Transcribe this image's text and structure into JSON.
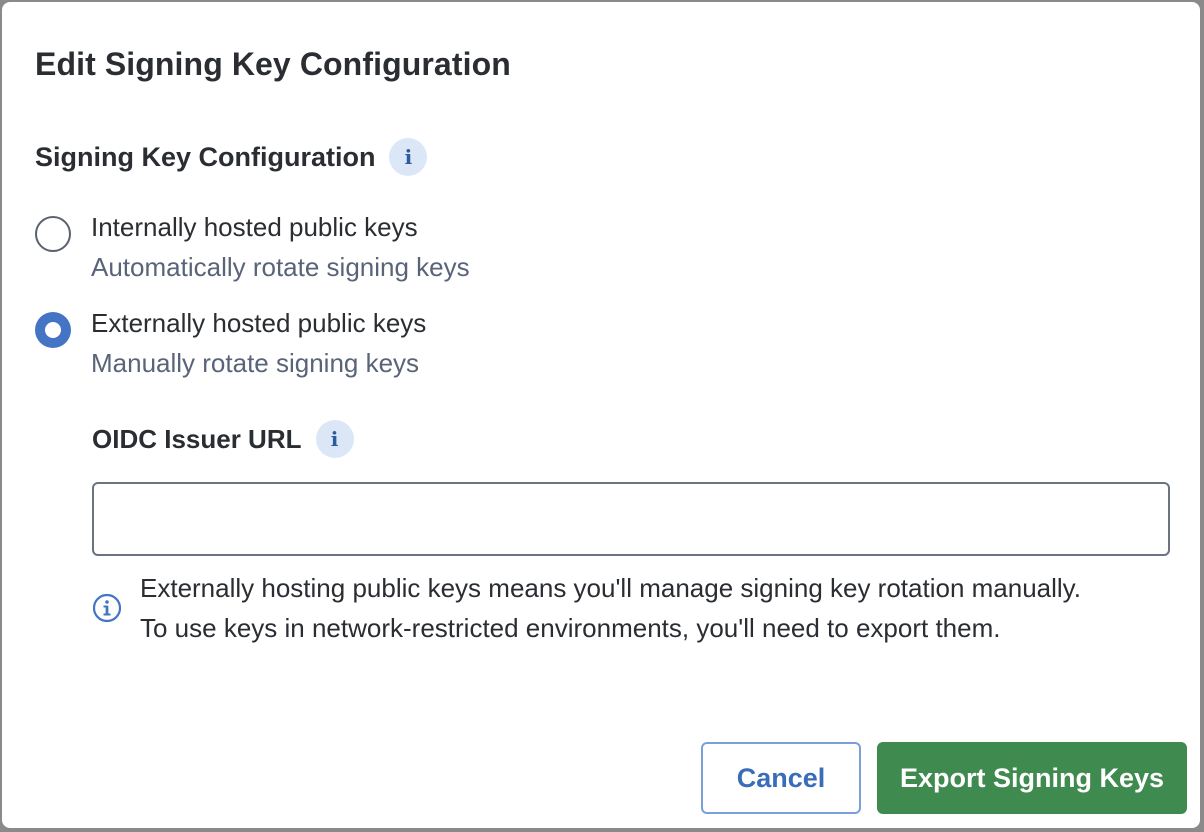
{
  "dialog": {
    "title": "Edit Signing Key Configuration",
    "section_label": "Signing Key Configuration",
    "options": [
      {
        "label": "Internally hosted public keys",
        "description": "Automatically rotate signing keys",
        "selected": false
      },
      {
        "label": "Externally hosted public keys",
        "description": "Manually rotate signing keys",
        "selected": true
      }
    ],
    "oidc_field": {
      "label": "OIDC Issuer URL",
      "value": "",
      "placeholder": ""
    },
    "helper_text": "Externally hosting public keys means you'll manage signing key rotation manually. To use keys in network-restricted environments, you'll need to export them.",
    "buttons": {
      "cancel_label": "Cancel",
      "export_label": "Export Signing Keys"
    }
  },
  "colors": {
    "accent": "#4475c5",
    "primary_button": "#3f8a4f",
    "info_badge_bg": "#dbe7f7"
  }
}
